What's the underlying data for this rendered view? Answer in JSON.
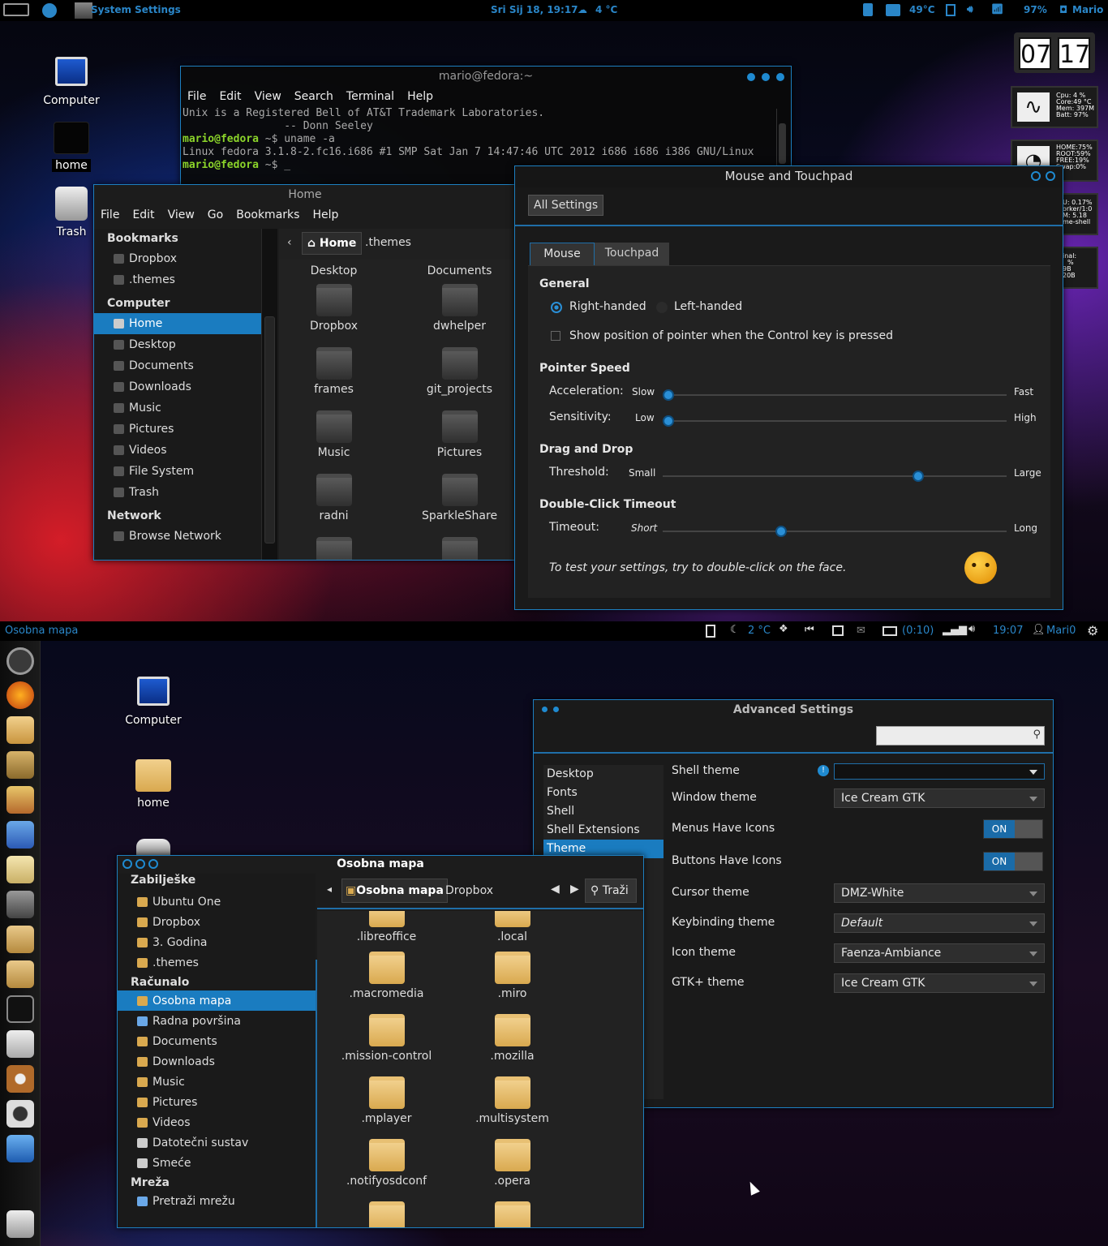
{
  "top_panel": {
    "app_title": "System Settings",
    "datetime": "Sri Sij 18, 19:17",
    "weather": "4 °C",
    "temperature": "49°C",
    "battery": "97%",
    "user": "Mario"
  },
  "desktop_top": {
    "icons": [
      "Computer",
      "home",
      "Trash"
    ]
  },
  "clock_widget": {
    "hour": "07",
    "minute": "17"
  },
  "sysmon": {
    "cpu": "Cpu: 4 %",
    "core": "Core:49 °C",
    "mem": "Mem: 397M",
    "batt": "Batt: 97%",
    "home": "HOME:75%",
    "root": "ROOT:59%",
    "free": "FREE:19%",
    "swap": "Swap:0%",
    "u": "U:  0.17%",
    "worker": "orker/1:0",
    "m": "M:  5.18",
    "shell": "me-shell",
    "inal": "inal:",
    "pct": "%",
    "b1": "9B",
    "b2": "20B"
  },
  "terminal": {
    "title": "mario@fedora:~",
    "menu": [
      "File",
      "Edit",
      "View",
      "Search",
      "Terminal",
      "Help"
    ],
    "line1": "Unix is a Registered Bell of AT&T Trademark Laboratories.",
    "line2": "                -- Donn Seeley",
    "prompt1": "mario@fedora",
    "cmd1": " ~$ uname -a",
    "line3": "Linux fedora 3.1.8-2.fc16.i686 #1 SMP Sat Jan 7 14:47:46 UTC 2012 i686 i686 i386 GNU/Linux",
    "prompt2": "mario@fedora",
    "cmd2": " ~$ _"
  },
  "nautilus_top": {
    "title": "Home",
    "menu": [
      "File",
      "Edit",
      "View",
      "Go",
      "Bookmarks",
      "Help"
    ],
    "bookmarks_header": "Bookmarks",
    "bookmarks": [
      "Dropbox",
      ".themes"
    ],
    "computer_header": "Computer",
    "computer": [
      "Home",
      "Desktop",
      "Documents",
      "Downloads",
      "Music",
      "Pictures",
      "Videos",
      "File System",
      "Trash"
    ],
    "network_header": "Network",
    "network": [
      "Browse Network"
    ],
    "path": [
      "Home",
      ".themes"
    ],
    "files": [
      "Desktop",
      "Documents",
      "Dropbox",
      "dwhelper",
      "frames",
      "git_projects",
      "Music",
      "Pictures",
      "radni",
      "SparkleShare"
    ]
  },
  "mouse": {
    "title": "Mouse and Touchpad",
    "all_settings": "All Settings",
    "tabs": [
      "Mouse",
      "Touchpad"
    ],
    "general": "General",
    "right_handed": "Right-handed",
    "left_handed": "Left-handed",
    "show_pointer": "Show position of pointer when the Control key is pressed",
    "pointer_speed": "Pointer Speed",
    "acceleration": "Acceleration:",
    "slow": "Slow",
    "fast": "Fast",
    "sensitivity": "Sensitivity:",
    "low": "Low",
    "high": "High",
    "drag_drop": "Drag and Drop",
    "threshold": "Threshold:",
    "small": "Small",
    "large": "Large",
    "dblclick": "Double-Click Timeout",
    "timeout": "Timeout:",
    "short": "Short",
    "long": "Long",
    "test_text": "To test your settings, try to double-click on the face.",
    "levels": {
      "acceleration": 0.0,
      "sensitivity": 0.0,
      "threshold": 0.75,
      "timeout": 0.34
    }
  },
  "bottom_panel": {
    "app_title": "Osobna mapa",
    "weather": "2 °C",
    "battery_time": "(0:10)",
    "time": "19:07",
    "user": "Mari0"
  },
  "desktop_bottom": {
    "icons": [
      "Computer",
      "home"
    ]
  },
  "advanced": {
    "title": "Advanced Settings",
    "categories": [
      "Desktop",
      "Fonts",
      "Shell",
      "Shell Extensions",
      "Theme"
    ],
    "selected": "Theme",
    "rows": {
      "shell_theme": "Shell theme",
      "window_theme": "Window theme",
      "window_theme_value": "Ice Cream GTK",
      "menus_icons": "Menus Have Icons",
      "buttons_icons": "Buttons Have Icons",
      "on": "ON",
      "cursor_theme": "Cursor theme",
      "cursor_theme_value": "DMZ-White",
      "keybinding_theme": "Keybinding theme",
      "keybinding_value": "Default",
      "icon_theme": "Icon theme",
      "icon_theme_value": "Faenza-Ambiance",
      "gtk_theme": "GTK+ theme",
      "gtk_theme_value": "Ice Cream GTK"
    }
  },
  "nautilus_bot": {
    "title": "Osobna mapa",
    "bookmarks_header": "Zabilješke",
    "bookmarks": [
      "Ubuntu One",
      "Dropbox",
      "3. Godina",
      ".themes"
    ],
    "computer_header": "Računalo",
    "computer": [
      "Osobna mapa",
      "Radna površina",
      "Documents",
      "Downloads",
      "Music",
      "Pictures",
      "Videos",
      "Datotečni sustav",
      "Smeće"
    ],
    "network_header": "Mreža",
    "network": [
      "Pretraži mrežu"
    ],
    "path": [
      "Osobna mapa",
      "Dropbox"
    ],
    "search": "Traži",
    "files": [
      ".libreoffice",
      ".local",
      ".macromedia",
      ".miro",
      ".mission-control",
      ".mozilla",
      ".mplayer",
      ".multisystem",
      ".notifyosdconf",
      ".opera"
    ]
  },
  "colors": {
    "accent": "#1f8ad0",
    "selection": "#1a7cc0",
    "folder": "#e0b463"
  }
}
